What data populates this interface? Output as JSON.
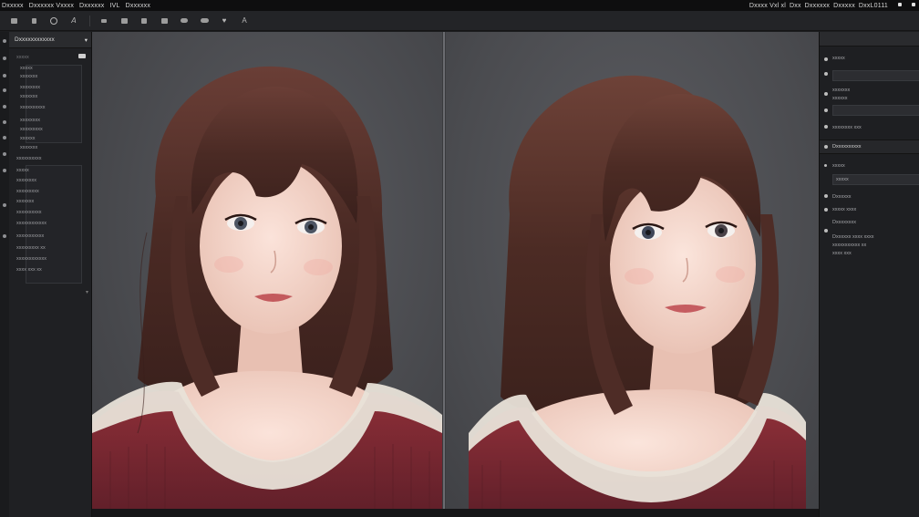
{
  "menubar": {
    "items": [
      "Dxxxxx",
      "Dxxxxxx Vxxxx",
      "Dxxxxxx",
      "IVL",
      "Dxxxxxx"
    ],
    "right_info": [
      "Dxxxx Vxl xl",
      "Dxx",
      "Dxxxxxx",
      "Dxxxxx",
      "DxxL0111"
    ]
  },
  "toolbar": {
    "tools": [
      "pan",
      "brush",
      "lasso",
      "text-a",
      "brush-2",
      "layers",
      "grid",
      "transform",
      "mask",
      "eye",
      "heart",
      "text-b"
    ]
  },
  "left_panel": {
    "title": "Dxxxxxxxxxxxx",
    "rows": [
      "xxxxx",
      "xxxxx",
      "xxxxxxx",
      "xxxxxxxx",
      "xxxxxxx",
      "xxxxxxxxxx",
      "xxxxxxxx",
      "xxxxxxxxx",
      "xxxxxx",
      "xxxxxxx",
      "xxxxxxxxxx",
      "xxxxx",
      "xxxxxxxx",
      "xxxxxxxxx",
      "xxxxxxx",
      "xxxxxxxxxx",
      "xxxxxxxxxxxx",
      "xxxxxxxxxxx",
      "xxxxxxxxx xx",
      "xxxxxxxxxxxx",
      "xxxx xxx xx"
    ]
  },
  "right_panel": {
    "rows": [
      "xxxxx",
      "xxxxxxx",
      "xxxxxx",
      "xxxxxxxx xxx",
      "Dxxxxxxxxxx",
      "xxxxx",
      "xxxxx",
      "Dxxxxxx",
      "xxxxx xxxx",
      "Dxxxxxxxx",
      "Dxxxxxx xxxx xxxx",
      "xxxxxxxxxxx xx",
      "xxxx xxx"
    ]
  },
  "colors": {
    "app_bg": "#1c1d1f",
    "canvas_bg": "#4b4c50",
    "sweater": "#7a2830",
    "lace": "#e8e1d8",
    "hair": "#4a2a24",
    "skin": "#f2d4c8"
  }
}
